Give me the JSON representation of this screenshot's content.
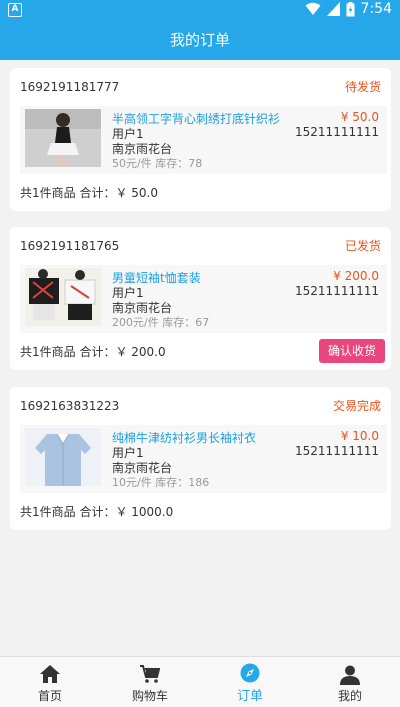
{
  "status_bar": {
    "left_icon": "A",
    "time": "7:54"
  },
  "header": {
    "title": "我的订单"
  },
  "orders": [
    {
      "order_no": "1692191181777",
      "status": "待发货",
      "item": {
        "name": "半高领工字背心刺绣打底针织衫",
        "price": "¥ 50.0",
        "user": "用户1",
        "phone": "15211111111",
        "address": "南京雨花台",
        "stock": "50元/件 库存：78"
      },
      "summary": "共1件商品 合计：￥ 50.0"
    },
    {
      "order_no": "1692191181765",
      "status": "已发货",
      "item": {
        "name": "男童短袖t恤套装",
        "price": "¥ 200.0",
        "user": "用户1",
        "phone": "15211111111",
        "address": "南京雨花台",
        "stock": "200元/件 库存：67"
      },
      "summary": "共1件商品 合计：￥ 200.0",
      "action": "确认收货"
    },
    {
      "order_no": "1692163831223",
      "status": "交易完成",
      "item": {
        "name": "纯棉牛津纺衬衫男长袖衬衣",
        "price": "¥ 10.0",
        "user": "用户1",
        "phone": "15211111111",
        "address": "南京雨花台",
        "stock": "10元/件 库存：186"
      },
      "summary": "共1件商品 合计：￥ 1000.0"
    }
  ],
  "bottom_nav": [
    {
      "label": "首页",
      "icon": "home-icon"
    },
    {
      "label": "购物车",
      "icon": "cart-icon"
    },
    {
      "label": "订单",
      "icon": "compass-icon",
      "active": true
    },
    {
      "label": "我的",
      "icon": "user-icon"
    }
  ],
  "colors": {
    "primary": "#26a7ea",
    "accent": "#e8541e",
    "button": "#e8467c",
    "link": "#1a9fe0"
  }
}
